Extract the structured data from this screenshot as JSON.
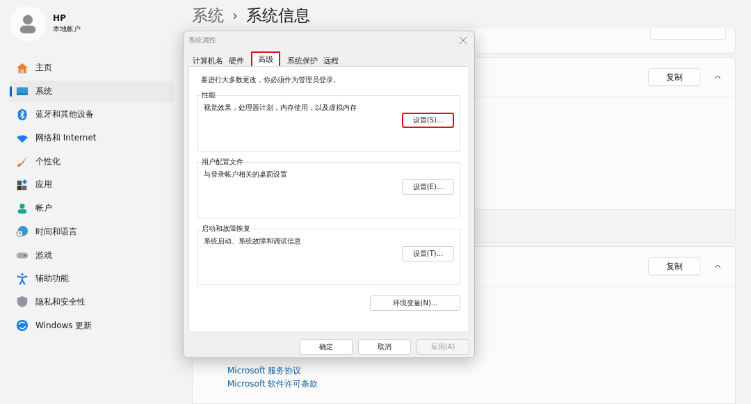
{
  "account": {
    "name": "HP",
    "type": "本地帐户"
  },
  "nav": [
    {
      "label": "主页",
      "selected": false
    },
    {
      "label": "系统",
      "selected": true
    },
    {
      "label": "蓝牙和其他设备",
      "selected": false
    },
    {
      "label": "网络和 Internet",
      "selected": false
    },
    {
      "label": "个性化",
      "selected": false
    },
    {
      "label": "应用",
      "selected": false
    },
    {
      "label": "帐户",
      "selected": false
    },
    {
      "label": "时间和语言",
      "selected": false
    },
    {
      "label": "游戏",
      "selected": false
    },
    {
      "label": "辅助功能",
      "selected": false
    },
    {
      "label": "隐私和安全性",
      "selected": false
    },
    {
      "label": "Windows 更新",
      "selected": false
    }
  ],
  "breadcrumb": {
    "parent": "系统",
    "separator": "›",
    "current": "系统信息"
  },
  "cards": [
    {
      "kind": "rename"
    },
    {
      "kind": "spec",
      "button": "复制",
      "expanded": true
    },
    {
      "kind": "spec",
      "button": "复制",
      "expanded": true
    }
  ],
  "links": [
    "Microsoft 服务协议",
    "Microsoft 软件许可条款"
  ],
  "dialog": {
    "title": "系统属性",
    "tabs": [
      {
        "label": "计算机名",
        "selected": false,
        "highlighted": false
      },
      {
        "label": "硬件",
        "selected": false,
        "highlighted": false
      },
      {
        "label": "高级",
        "selected": true,
        "highlighted": true
      },
      {
        "label": "系统保护",
        "selected": false,
        "highlighted": false
      },
      {
        "label": "远程",
        "selected": false,
        "highlighted": false
      }
    ],
    "notice": "要进行大多数更改，你必须作为管理员登录。",
    "groups": [
      {
        "title": "性能",
        "description": "视觉效果，处理器计划，内存使用，以及虚拟内存",
        "button": "设置(S)...",
        "highlighted": true
      },
      {
        "title": "用户配置文件",
        "description": "与登录帐户相关的桌面设置",
        "button": "设置(E)...",
        "highlighted": false
      },
      {
        "title": "启动和故障恢复",
        "description": "系统启动、系统故障和调试信息",
        "button": "设置(T)...",
        "highlighted": false
      }
    ],
    "env_button": "环境变量(N)...",
    "buttons": [
      {
        "label": "确定",
        "disabled": false
      },
      {
        "label": "取消",
        "disabled": false
      },
      {
        "label": "应用(A)",
        "disabled": true
      }
    ]
  }
}
